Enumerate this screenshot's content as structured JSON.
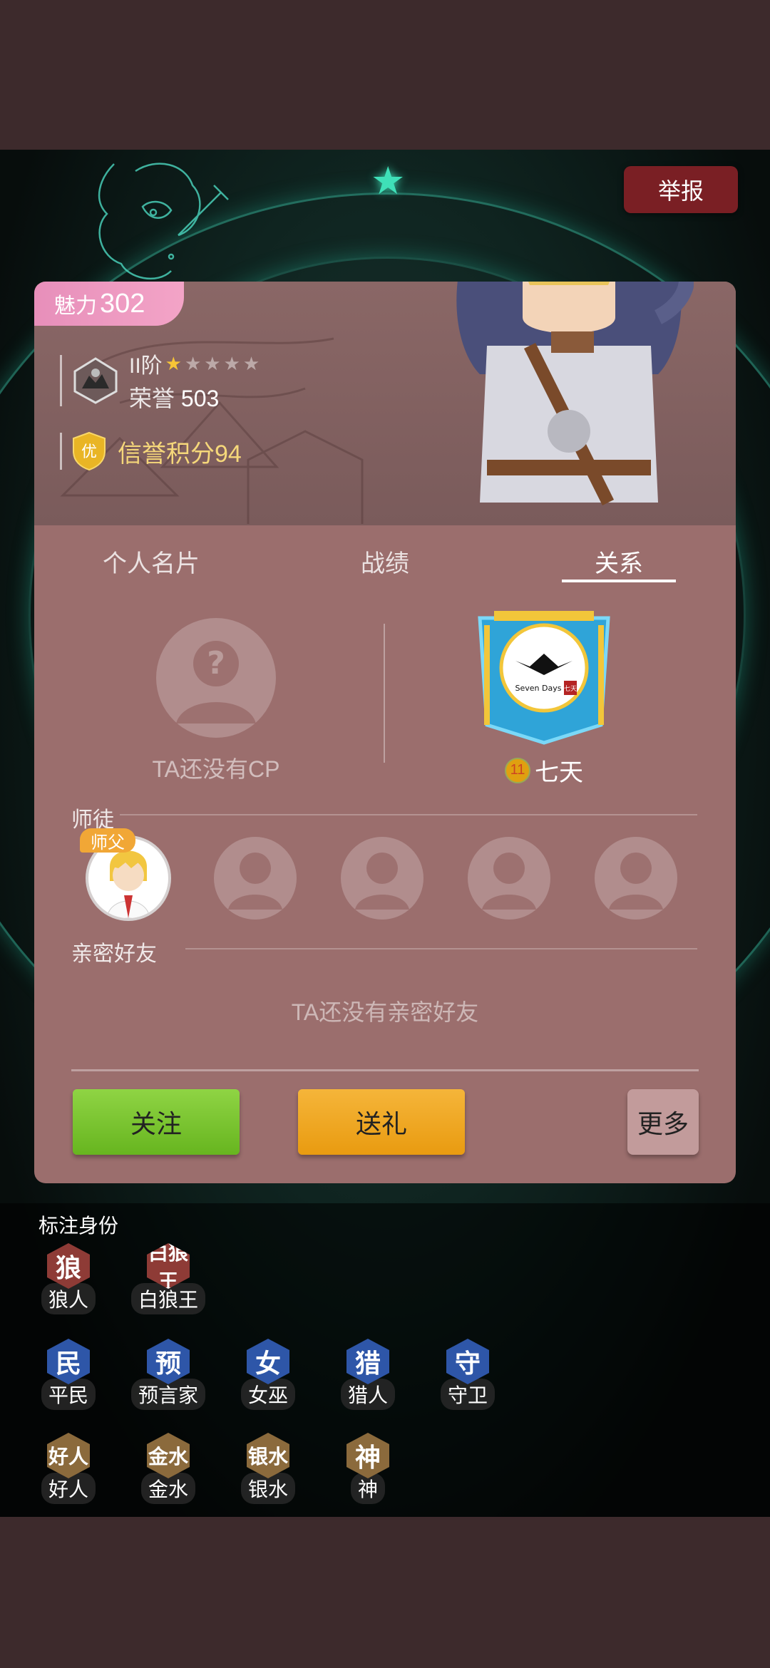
{
  "report_label": "举报",
  "charm": {
    "label": "魅力",
    "value": "302"
  },
  "rank": {
    "tier": "II阶",
    "stars_total": 5,
    "stars_filled": 1,
    "honor_label": "荣誉",
    "honor_value": "503"
  },
  "credit": {
    "badge": "优",
    "text": "信誉积分94"
  },
  "tabs": [
    {
      "label": "个人名片",
      "active": false
    },
    {
      "label": "战绩",
      "active": false
    },
    {
      "label": "关系",
      "active": true
    }
  ],
  "cp": {
    "empty_text": "TA还没有CP"
  },
  "guild": {
    "level": "11",
    "name": "七天",
    "logo_text": "Seven Days",
    "logo_stamp": "七天"
  },
  "mentor": {
    "title": "师徒",
    "master_tag": "师父"
  },
  "friends": {
    "title": "亲密好友",
    "empty_text": "TA还没有亲密好友"
  },
  "actions": {
    "follow": "关注",
    "gift": "送礼",
    "more": "更多"
  },
  "roles": {
    "title": "标注身份",
    "items": [
      {
        "glyph": "狼",
        "label": "狼人",
        "tone": "red"
      },
      {
        "glyph": "白狼王",
        "label": "白狼王",
        "tone": "red"
      },
      {
        "glyph": "民",
        "label": "平民",
        "tone": "blue"
      },
      {
        "glyph": "预",
        "label": "预言家",
        "tone": "blue"
      },
      {
        "glyph": "女",
        "label": "女巫",
        "tone": "blue"
      },
      {
        "glyph": "猎",
        "label": "猎人",
        "tone": "blue"
      },
      {
        "glyph": "守",
        "label": "守卫",
        "tone": "blue"
      },
      {
        "glyph": "好人",
        "label": "好人",
        "tone": "brown"
      },
      {
        "glyph": "金水",
        "label": "金水",
        "tone": "brown"
      },
      {
        "glyph": "银水",
        "label": "银水",
        "tone": "brown"
      },
      {
        "glyph": "神",
        "label": "神",
        "tone": "brown"
      }
    ]
  },
  "colors": {
    "card": "#9b6e6d",
    "charm": "#f3a4c7",
    "report": "#7a1f24",
    "follow": "#7bc52f",
    "gift": "#f0a824"
  }
}
